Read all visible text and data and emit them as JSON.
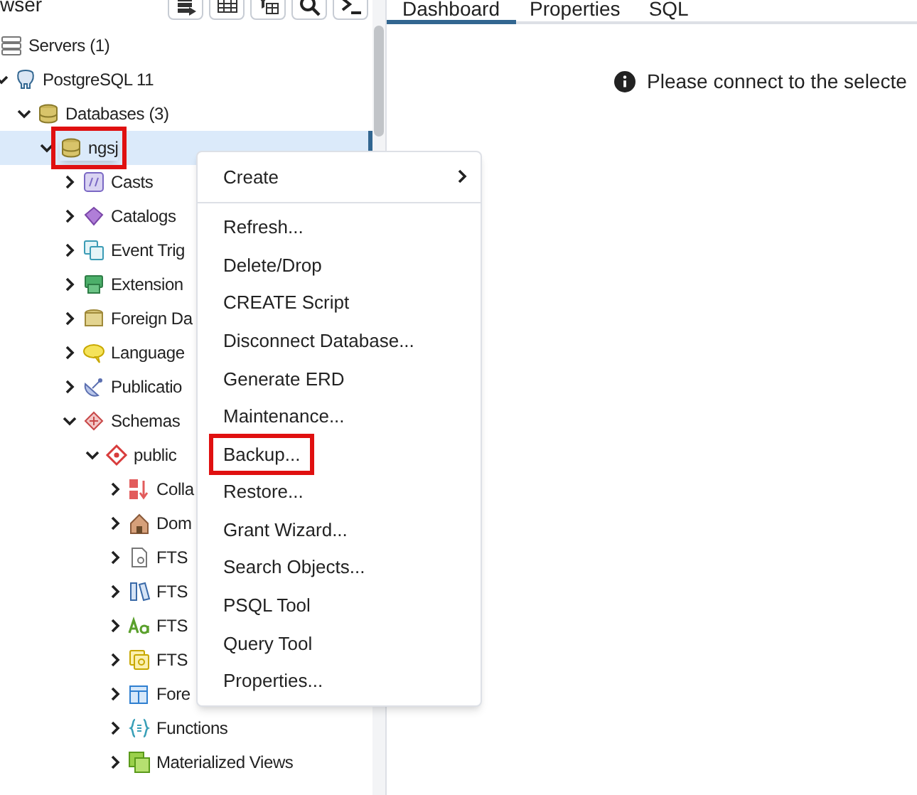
{
  "browser": {
    "title": "wser",
    "toolbar": [
      {
        "kind": "storage"
      },
      {
        "kind": "grid"
      },
      {
        "kind": "filtered-grid"
      },
      {
        "kind": "search"
      },
      {
        "kind": "terminal"
      }
    ],
    "tree": [
      {
        "label": "Servers (1)",
        "kind": "servers",
        "children": [
          {
            "label": "PostgreSQL 11",
            "kind": "server",
            "expanded": true,
            "children": [
              {
                "label": "Databases (3)",
                "kind": "database",
                "expanded": true,
                "children": [
                  {
                    "label": "ngsj",
                    "kind": "database",
                    "expanded": true,
                    "selected": true,
                    "highlighted": true,
                    "children": [
                      {
                        "label": "Casts",
                        "kind": "casts",
                        "expanded": false
                      },
                      {
                        "label": "Catalogs",
                        "kind": "catalogs",
                        "expanded": false
                      },
                      {
                        "label": "Event Trig",
                        "kind": "trigger",
                        "expanded": false
                      },
                      {
                        "label": "Extension",
                        "kind": "extension",
                        "expanded": false
                      },
                      {
                        "label": "Foreign Da",
                        "kind": "foreign",
                        "expanded": false
                      },
                      {
                        "label": "Language",
                        "kind": "language",
                        "expanded": false
                      },
                      {
                        "label": "Publicatio",
                        "kind": "publication",
                        "expanded": false
                      },
                      {
                        "label": "Schemas",
                        "kind": "schemas",
                        "expanded": true,
                        "children": [
                          {
                            "label": "public",
                            "kind": "schema",
                            "expanded": true,
                            "children": [
                              {
                                "label": "Colla",
                                "kind": "collation",
                                "expanded": false
                              },
                              {
                                "label": "Dom",
                                "kind": "domain",
                                "expanded": false
                              },
                              {
                                "label": "FTS",
                                "kind": "fts-config",
                                "expanded": false
                              },
                              {
                                "label": "FTS",
                                "kind": "fts-dict",
                                "expanded": false
                              },
                              {
                                "label": "FTS",
                                "kind": "fts-parser",
                                "expanded": false
                              },
                              {
                                "label": "FTS",
                                "kind": "fts-template",
                                "expanded": false
                              },
                              {
                                "label": "Fore",
                                "kind": "foreign-table",
                                "expanded": false
                              },
                              {
                                "label": "Functions",
                                "kind": "functions",
                                "expanded": false
                              },
                              {
                                "label": "Materialized Views",
                                "kind": "matview",
                                "expanded": false
                              }
                            ]
                          }
                        ]
                      }
                    ]
                  }
                ]
              }
            ]
          }
        ]
      }
    ]
  },
  "tabs": [
    {
      "label": "Dashboard",
      "selected": true
    },
    {
      "label": "Properties",
      "selected": false
    },
    {
      "label": "SQL",
      "selected": false
    }
  ],
  "message": "Please connect to the selecte",
  "context_menu": [
    {
      "label": "Create",
      "submenu": true,
      "separator_after": true,
      "highlighted": false
    },
    {
      "label": "Refresh...",
      "submenu": false,
      "highlighted": false
    },
    {
      "label": "Delete/Drop",
      "submenu": false,
      "highlighted": false
    },
    {
      "label": "CREATE Script",
      "submenu": false,
      "highlighted": false
    },
    {
      "label": "Disconnect Database...",
      "submenu": false,
      "highlighted": false
    },
    {
      "label": "Generate ERD",
      "submenu": false,
      "highlighted": false
    },
    {
      "label": "Maintenance...",
      "submenu": false,
      "highlighted": false
    },
    {
      "label": "Backup...",
      "submenu": false,
      "highlighted": true
    },
    {
      "label": "Restore...",
      "submenu": false,
      "highlighted": false
    },
    {
      "label": "Grant Wizard...",
      "submenu": false,
      "highlighted": false
    },
    {
      "label": "Search Objects...",
      "submenu": false,
      "highlighted": false
    },
    {
      "label": "PSQL Tool",
      "submenu": false,
      "highlighted": false
    },
    {
      "label": "Query Tool",
      "submenu": false,
      "highlighted": false
    },
    {
      "label": "Properties...",
      "submenu": false,
      "highlighted": false
    }
  ]
}
